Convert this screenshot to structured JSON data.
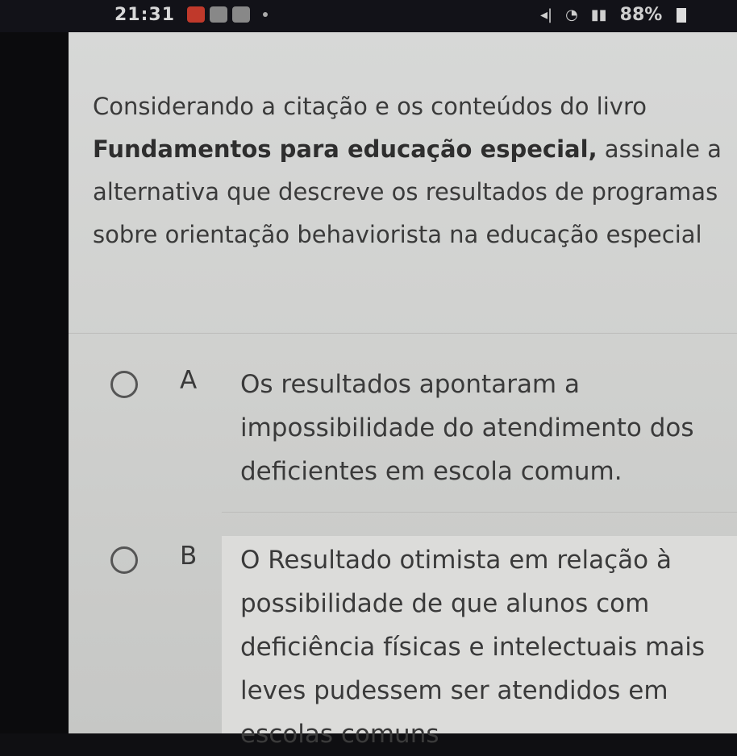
{
  "status_bar": {
    "time": "21:31",
    "battery": "88%"
  },
  "question": {
    "part1": "Considerando a citação e os conteúdos do livro ",
    "book_title": "Fundamentos para educação especial,",
    "part2": " assinale a alternativa que descreve os resultados de programas sobre orientação behaviorista na educação especial"
  },
  "options": [
    {
      "letter": "A",
      "text": "Os resultados apontaram a impossibilidade do atendimento dos deficientes em escola comum."
    },
    {
      "letter": "B",
      "text": "O Resultado otimista em relação à possibilidade de que alunos com deficiência físicas e intelectuais mais leves pudessem ser atendidos em escolas comuns"
    }
  ]
}
